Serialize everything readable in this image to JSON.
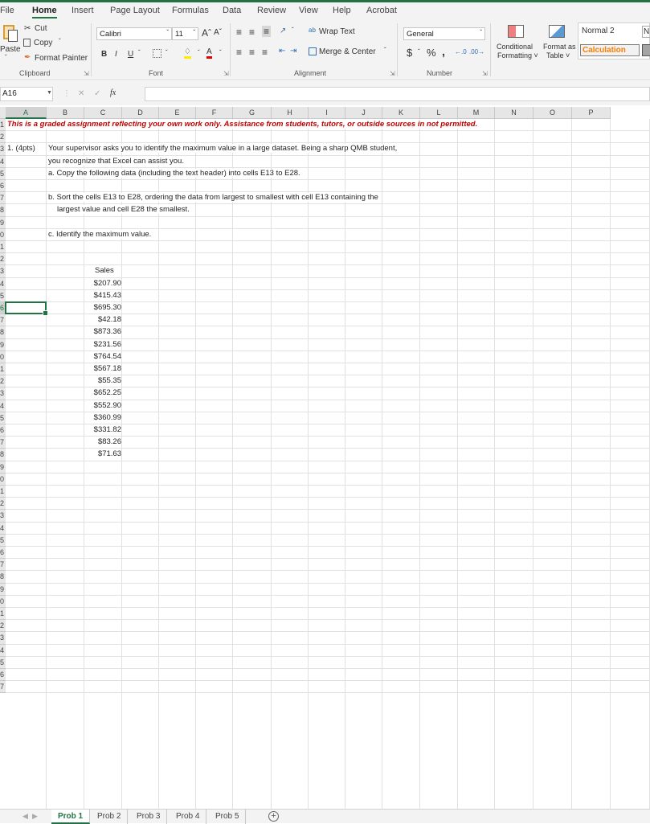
{
  "app": {
    "accent": "#217346"
  },
  "menu": [
    "File",
    "Home",
    "Insert",
    "Page Layout",
    "Formulas",
    "Data",
    "Review",
    "View",
    "Help",
    "Acrobat"
  ],
  "menu_active": "Home",
  "ribbon": {
    "clipboard": {
      "paste": "Paste",
      "cut": "Cut",
      "copy": "Copy",
      "format_painter": "Format Painter",
      "label": "Clipboard"
    },
    "font": {
      "name": "Calibri",
      "size": "11",
      "grow": "Aˆ",
      "shrink": "Aˇ",
      "bold": "B",
      "italic": "I",
      "underline": "U",
      "label": "Font"
    },
    "alignment": {
      "wrap_text": "Wrap Text",
      "merge_center": "Merge & Center",
      "label": "Alignment"
    },
    "number": {
      "format": "General",
      "currency": "$",
      "percent": "%",
      "comma": "̹",
      "inc_decimal": ".00→",
      "dec_decimal": "→.0",
      "label": "Number"
    },
    "styles": {
      "conditional_formatting": [
        "Conditional",
        "Formatting ˅"
      ],
      "format_as_table": [
        "Format as",
        "Table ˅"
      ],
      "style1": "Normal 2",
      "style2": "Calculation",
      "style_partial": "N"
    }
  },
  "formula_bar": {
    "name_box": "A16",
    "cancel": "✕",
    "enter": "✓",
    "fx": "fx",
    "value": ""
  },
  "columns": [
    "A",
    "B",
    "C",
    "D",
    "E",
    "F",
    "G",
    "H",
    "I",
    "J",
    "K",
    "L",
    "M",
    "N",
    "O",
    "P"
  ],
  "selected_column": "A",
  "row_labels": [
    "1",
    "2",
    "3",
    "4",
    "5",
    "6",
    "7",
    "8",
    "9",
    "0",
    "1",
    "2",
    "3",
    "4",
    "5",
    "6",
    "7",
    "8",
    "9",
    "0",
    "1",
    "2",
    "3",
    "4",
    "5",
    "6",
    "7",
    "8",
    "9",
    "0",
    "1",
    "2",
    "3",
    "4",
    "5",
    "6",
    "7",
    "8",
    "9",
    "0",
    "1",
    "2",
    "3",
    "4",
    "5",
    "6",
    "7"
  ],
  "cells": {
    "A1": "This is a graded assignment reflecting your own work only.  Assistance from students, tutors, or outside sources in not permitted.",
    "A3": "1. (4pts)",
    "B3": "Your supervisor asks you to identify the maximum value in a large dataset.   Being a sharp QMB student,",
    "B4": "you recognize that Excel can assist you.",
    "B5": "a.  Copy the following data (including the text header) into cells E13 to E28.",
    "B7": "b.  Sort the cells E13 to E28, ordering the data from largest to smallest with cell E13 containing the",
    "B8": "largest value and cell E28 the smallest.",
    "B10": "c.  Identify the maximum value."
  },
  "sales": {
    "header": "Sales",
    "values": [
      "$207.90",
      "$415.43",
      "$695.30",
      "$42.18",
      "$873.36",
      "$231.56",
      "$764.54",
      "$567.18",
      "$55.35",
      "$652.25",
      "$552.90",
      "$360.99",
      "$331.82",
      "$83.26",
      "$71.63"
    ]
  },
  "sheets": [
    "Prob 1",
    "Prob 2",
    "Prob 3",
    "Prob 4",
    "Prob 5"
  ],
  "active_sheet": "Prob 1",
  "add_sheet": "+"
}
